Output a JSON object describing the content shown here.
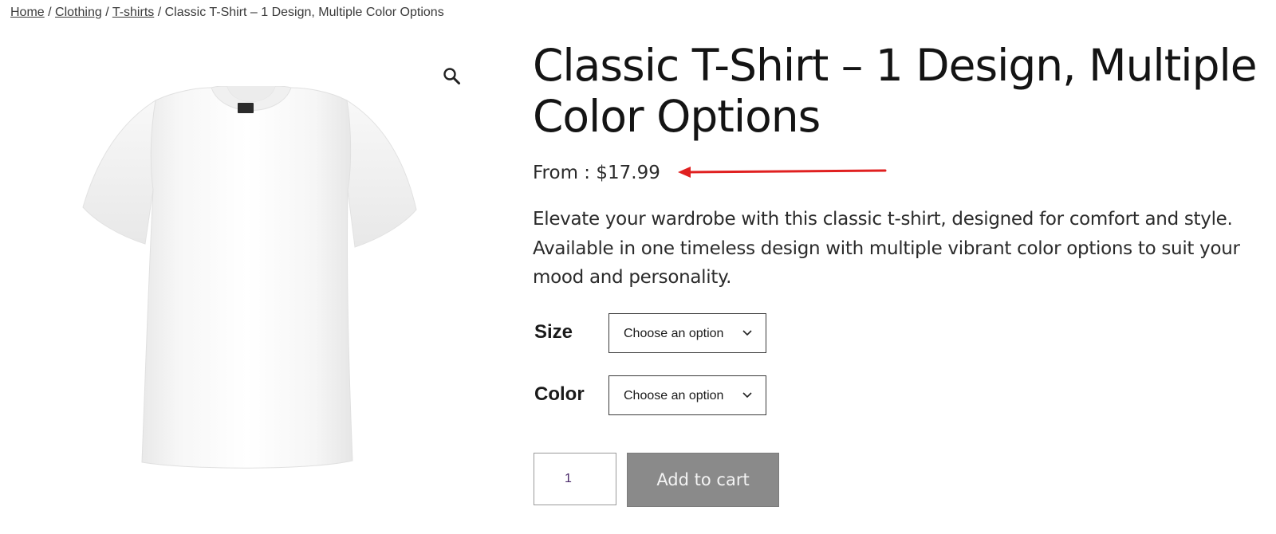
{
  "breadcrumb": {
    "items": [
      {
        "label": "Home"
      },
      {
        "label": "Clothing"
      },
      {
        "label": "T-shirts"
      }
    ],
    "separator": "/",
    "current": "Classic T-Shirt – 1 Design, Multiple Color Options"
  },
  "gallery": {
    "zoom_icon": "magnifier-icon",
    "image_alt": "white-tshirt-image"
  },
  "product": {
    "title": "Classic T-Shirt – 1 Design, Multiple Color Options",
    "price": "From : $17.99",
    "description": "Elevate your wardrobe with this classic t-shirt, designed for comfort and style. Available in one timeless design with multiple vibrant color options to suit your mood and personality."
  },
  "variations": {
    "size": {
      "label": "Size",
      "selected": "Choose an option"
    },
    "color": {
      "label": "Color",
      "selected": "Choose an option"
    }
  },
  "cart": {
    "quantity": "1",
    "add_label": "Add to cart"
  },
  "colors": {
    "annotation_arrow": "#e02020",
    "add_button_bg": "#8a8a8a"
  }
}
